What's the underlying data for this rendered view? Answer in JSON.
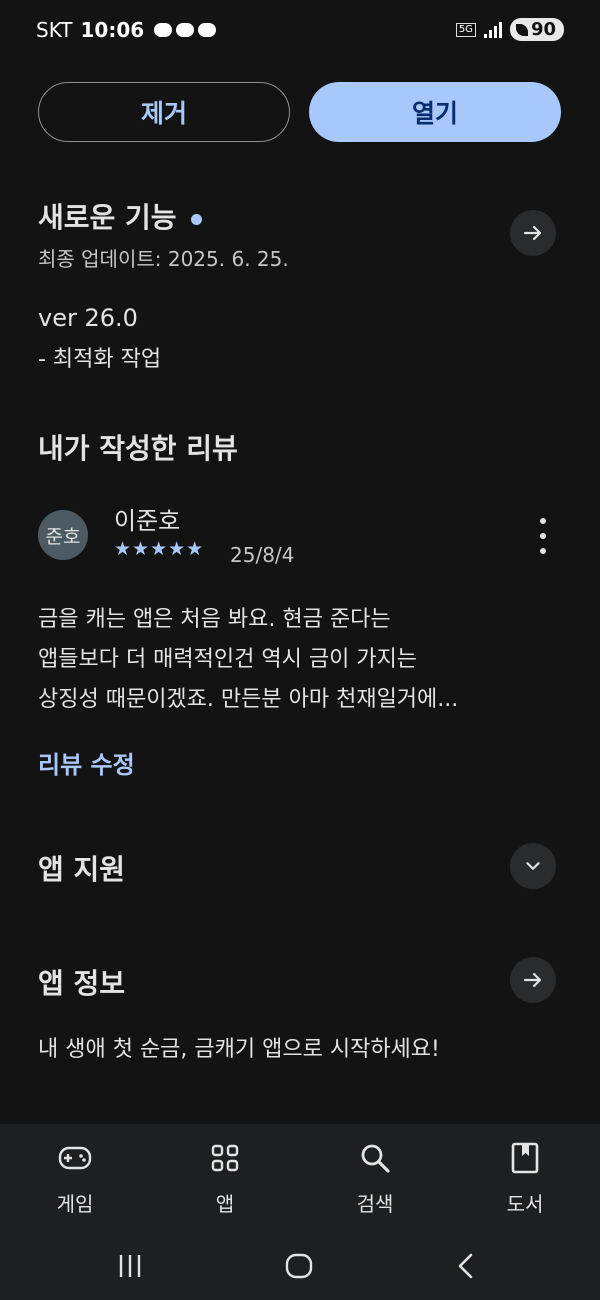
{
  "status_bar": {
    "carrier": "SKT",
    "time": "10:06",
    "network": "5G",
    "battery": "90"
  },
  "actions": {
    "remove_label": "제거",
    "open_label": "열기"
  },
  "whats_new": {
    "title": "새로운 기능",
    "updated": "최종 업데이트: 2025. 6. 25.",
    "version": "ver 26.0",
    "note": "- 최적화 작업"
  },
  "my_review": {
    "section_title": "내가 작성한 리뷰",
    "avatar_text": "준호",
    "reviewer": "이준호",
    "stars": "★★★★★",
    "rating": 5,
    "date": "25/8/4",
    "lines": [
      "금을 캐는 앱은 처음 봐요. 현금 준다는",
      "앱들보다 더 매력적인건 역시 금이 가지는",
      "상징성 때문이겠죠. 만든분 아마 천재일거에..."
    ],
    "edit_label": "리뷰 수정"
  },
  "app_support": {
    "title": "앱 지원"
  },
  "app_info": {
    "title": "앱 정보",
    "description": "내 생애 첫 순금, 금캐기 앱으로 시작하세요!"
  },
  "bottom_nav": [
    {
      "label": "게임",
      "icon": "gamepad-icon"
    },
    {
      "label": "앱",
      "icon": "apps-grid-icon"
    },
    {
      "label": "검색",
      "icon": "search-icon"
    },
    {
      "label": "도서",
      "icon": "book-icon"
    }
  ],
  "colors": {
    "background": "#131314",
    "accent": "#a8c7fa",
    "open_button_text": "#062e6f"
  }
}
